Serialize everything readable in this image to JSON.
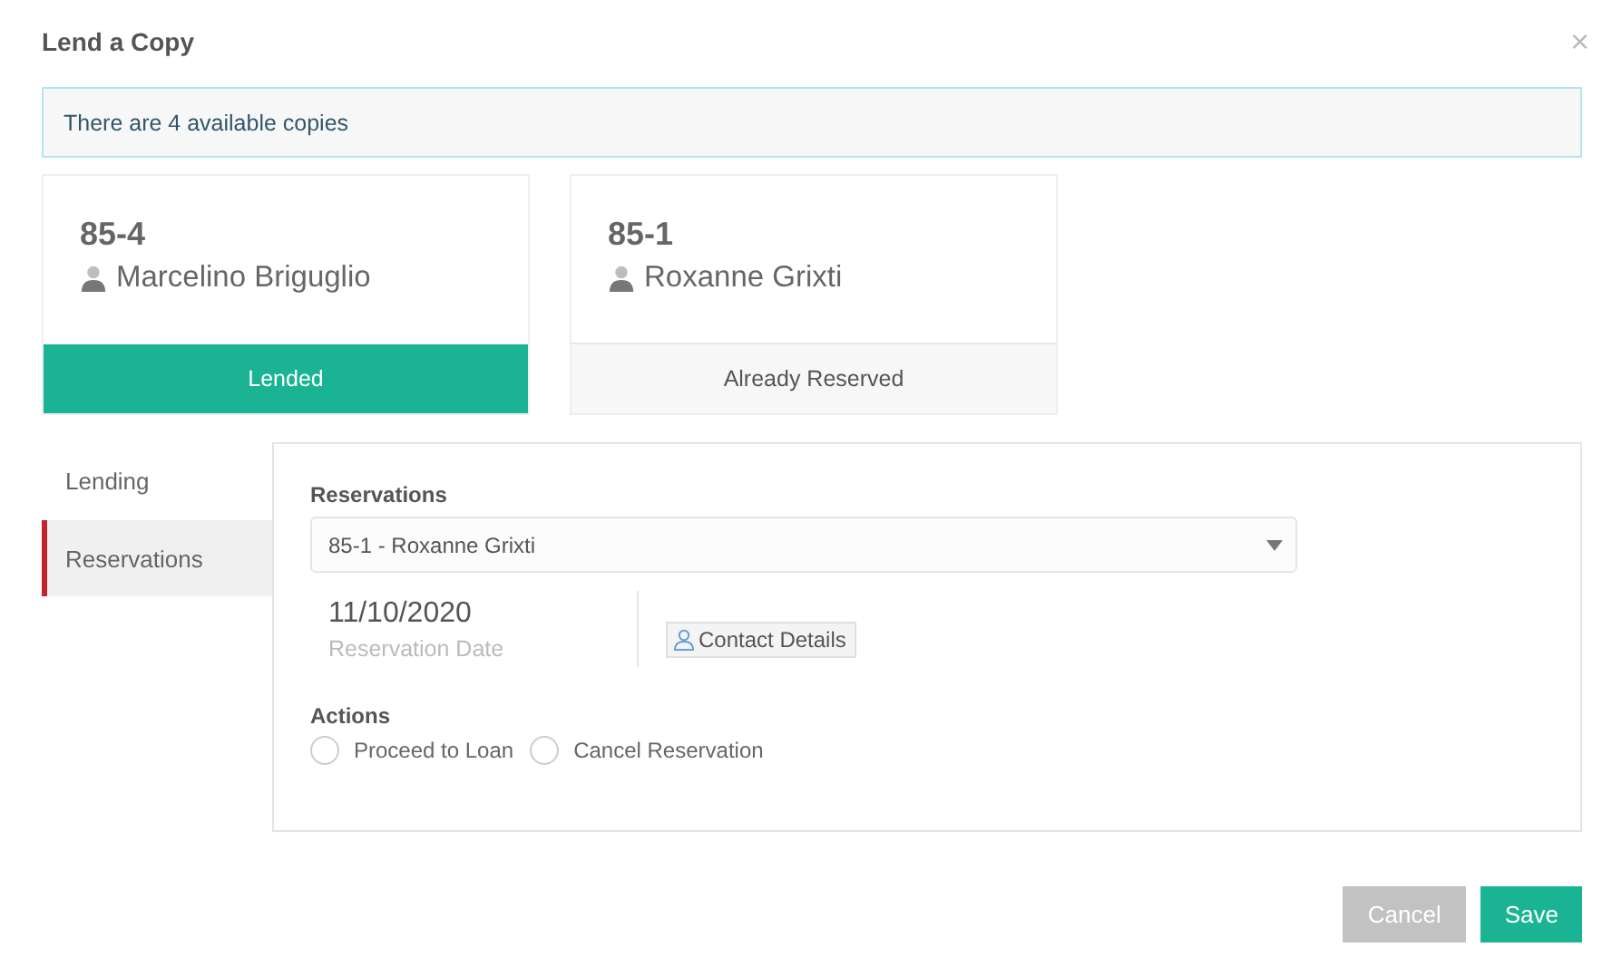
{
  "dialog": {
    "title": "Lend a Copy",
    "close": "×"
  },
  "alert": "There are 4 available copies",
  "copies": [
    {
      "code": "85-4",
      "borrower": "Marcelino Briguglio",
      "status": "Lended",
      "kind": "lended"
    },
    {
      "code": "85-1",
      "borrower": "Roxanne Grixti",
      "status": "Already Reserved",
      "kind": "reserved"
    }
  ],
  "tabs": [
    {
      "label": "Lending",
      "selected": false
    },
    {
      "label": "Reservations",
      "selected": true
    }
  ],
  "reservations": {
    "label": "Reservations",
    "select_value": "85-1 - Roxanne Grixti",
    "date": "11/10/2020",
    "date_label": "Reservation Date",
    "contact_button": "Contact Details"
  },
  "actions": {
    "label": "Actions",
    "options": [
      {
        "label": "Proceed to Loan",
        "selected": false
      },
      {
        "label": "Cancel Reservation",
        "selected": false
      }
    ]
  },
  "buttons": [
    {
      "label": "Cancel",
      "kind": "secondary"
    },
    {
      "label": "Save",
      "kind": "primary"
    }
  ]
}
